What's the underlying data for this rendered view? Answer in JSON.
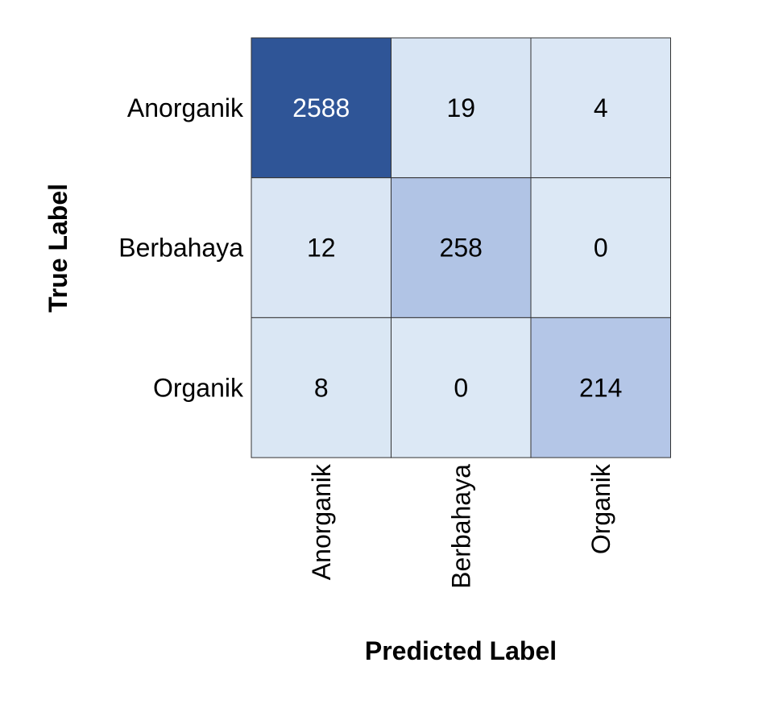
{
  "chart_data": {
    "type": "heatmap",
    "title": "",
    "xlabel": "Predicted Label",
    "ylabel": "True Label",
    "x_categories": [
      "Anorganik",
      "Berbahaya",
      "Organik"
    ],
    "y_categories": [
      "Anorganik",
      "Berbahaya",
      "Organik"
    ],
    "matrix": [
      [
        2588,
        19,
        4
      ],
      [
        12,
        258,
        0
      ],
      [
        8,
        0,
        214
      ]
    ],
    "colors": {
      "low": "#dce8f5",
      "mid": "#b4c6e7",
      "high": "#2f5597",
      "text_dark": "#000000",
      "text_light": "#ffffff",
      "border": "#333333"
    },
    "grid": true,
    "legend": "none"
  }
}
